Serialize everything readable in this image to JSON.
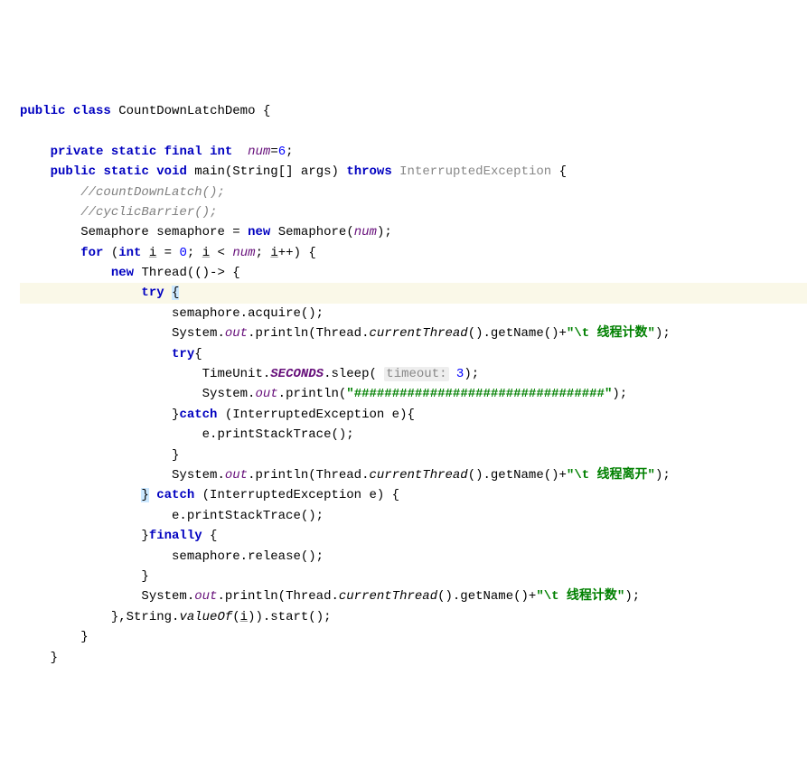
{
  "code": {
    "class_decl": {
      "kw_public": "public",
      "kw_class": "class",
      "name": "CountDownLatchDemo",
      "brace": "{"
    },
    "field_decl": {
      "kw_private": "private",
      "kw_static": "static",
      "kw_final": "final",
      "kw_int": "int",
      "name": "num",
      "eq": "=",
      "val": "6",
      "semi": ";"
    },
    "main_decl": {
      "kw_public": "public",
      "kw_static": "static",
      "kw_void": "void",
      "name": "main",
      "args": "(String[] args)",
      "kw_throws": "throws",
      "ex": "InterruptedException",
      "brace": "{"
    },
    "comment1": "//countDownLatch();",
    "comment2": "//cyclicBarrier();",
    "sema_line": {
      "type": "Semaphore",
      "var": "semaphore",
      "eq": " = ",
      "kw_new": "new",
      "ctor": " Semaphore(",
      "arg": "num",
      "end": ");"
    },
    "for_line": {
      "kw_for": "for",
      "open": " (",
      "kw_int": "int",
      "var": "i",
      "eq": " = ",
      "zero": "0",
      "sep1": "; ",
      "var2": "i",
      "lt": " < ",
      "num": "num",
      "sep2": "; ",
      "var3": "i",
      "pp": "++",
      "close": ") {"
    },
    "thread_line": {
      "kw_new": "new",
      "type": " Thread(()-> {"
    },
    "try": "try",
    "open_brace": "{",
    "acquire": {
      "obj": "semaphore",
      "dot": ".",
      "m": "acquire();"
    },
    "println1": {
      "pre": "System.",
      "out": "out",
      "mid": ".println(Thread.",
      "ct": "currentThread",
      "post": "().getName()+",
      "str": "\"\\t 线程计数\"",
      "end": ");"
    },
    "try2": "try",
    "ob2": "{",
    "sleep": {
      "pre": "TimeUnit.",
      "secs": "SECONDS",
      "mid": ".sleep( ",
      "hint": "timeout:",
      "sp": " ",
      "val": "3",
      "end": ");"
    },
    "println2": {
      "pre": "System.",
      "out": "out",
      "mid": ".println(",
      "str": "\"#################################\"",
      "end": ");"
    },
    "catch_inner": {
      "close": "}",
      "kw_catch": "catch",
      "args": " (InterruptedException e){"
    },
    "pst": "e.printStackTrace();",
    "close_inner": "}",
    "println3": {
      "pre": "System.",
      "out": "out",
      "mid": ".println(Thread.",
      "ct": "currentThread",
      "post": "().getName()+",
      "str": "\"\\t 线程离开\"",
      "end": ");"
    },
    "catch_outer": {
      "close": "}",
      "kw_catch": "catch",
      "args": " (InterruptedException e) {"
    },
    "pst2": "e.printStackTrace();",
    "finally": {
      "close": "}",
      "kw": "finally",
      "brace": " {"
    },
    "release": {
      "obj": "semaphore",
      "dot": ".",
      "m": "release();"
    },
    "close_fin": "}",
    "println4": {
      "pre": "System.",
      "out": "out",
      "mid": ".println(Thread.",
      "ct": "currentThread",
      "post": "().getName()+",
      "str": "\"\\t 线程计数\"",
      "end": ");"
    },
    "thread_end": {
      "close": "},String.",
      "vo": "valueOf",
      "args": "(",
      "i": "i",
      "end": ")).start();"
    },
    "close_for": "}",
    "close_main": "}"
  }
}
